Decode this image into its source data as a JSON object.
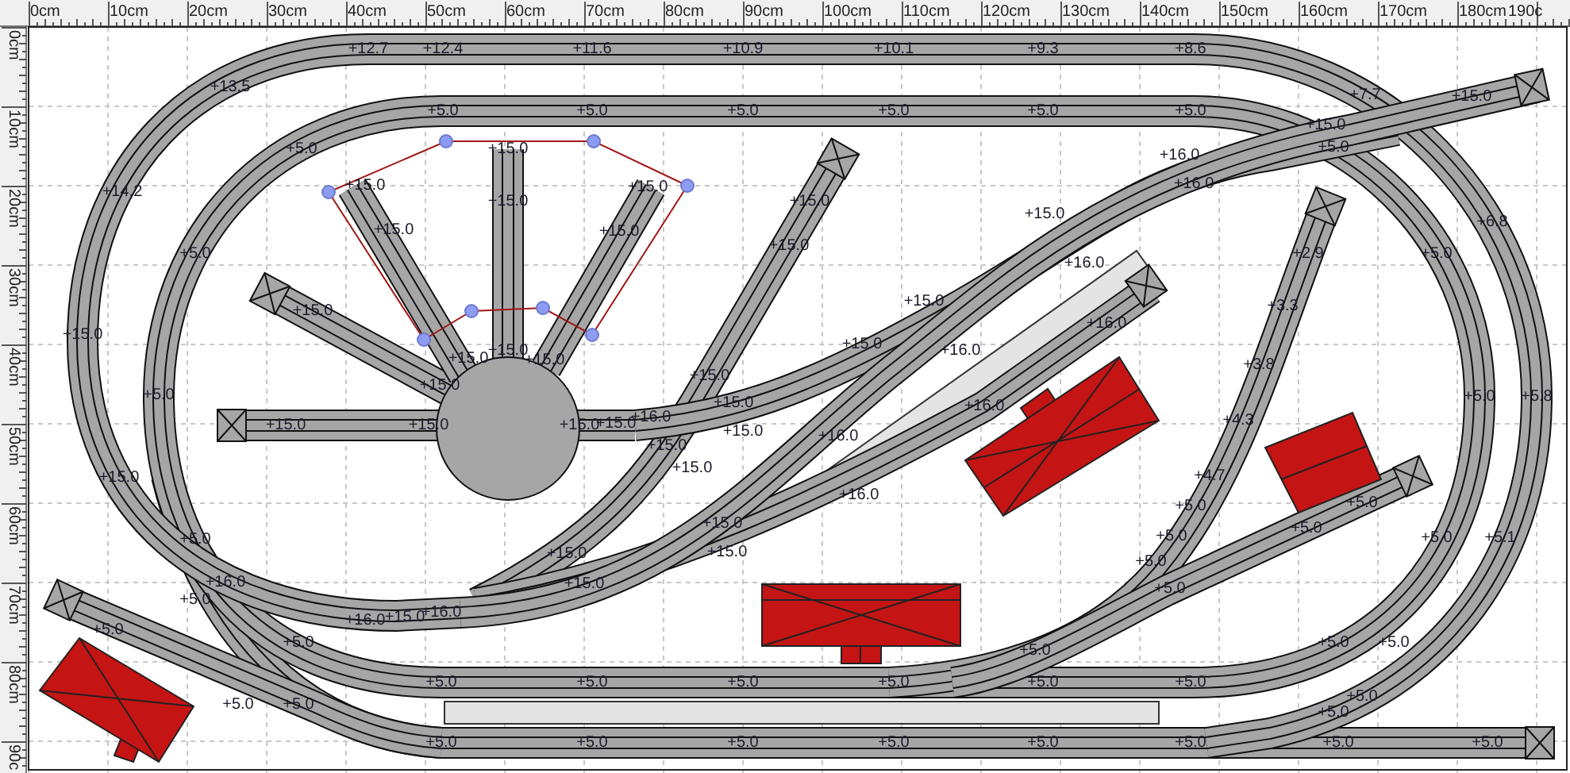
{
  "ruler": {
    "horizontal": [
      "0cm",
      "10cm",
      "20cm",
      "30cm",
      "40cm",
      "50cm",
      "60cm",
      "70cm",
      "80cm",
      "90cm",
      "100cm",
      "110cm",
      "120cm",
      "130cm",
      "140cm",
      "150cm",
      "160cm",
      "170cm",
      "180cm",
      "190c"
    ],
    "vertical": [
      "0cm",
      "10cm",
      "20cm",
      "30cm",
      "40cm",
      "50cm",
      "60cm",
      "70cm",
      "80cm",
      "90c"
    ]
  },
  "elevation_labels": [
    "+12.7",
    "+12.4",
    "+11.6",
    "+10.9",
    "+10.1",
    "+9.3",
    "+8.6",
    "+13.5",
    "+7.7",
    "+15.0",
    "+5.0",
    "+5.0",
    "+5.0",
    "+5.0",
    "+5.0",
    "+5.0",
    "+15.0",
    "+5.0",
    "+15.0",
    "+16.0",
    "+5.0",
    "+14.2",
    "+15.0",
    "+15.0",
    "+16.0",
    "+15.0",
    "+15.0",
    "+15.0",
    "+6.8",
    "+15.0",
    "+15.0",
    "+15.0",
    "+5.0",
    "+16.0",
    "+2.9",
    "+5.0",
    "+15.0",
    "+15.0",
    "+3.3",
    "+16.0",
    "+15.0",
    "+15.0",
    "+15.0",
    "+15.0",
    "+15.0",
    "+16.0",
    "+3.8",
    "+15.0",
    "+15.0",
    "+5.0",
    "+15.0",
    "+16.0",
    "+5.0",
    "+5.8",
    "+15.0",
    "+15.0",
    "+15.0",
    "+15.0",
    "+16.0",
    "+15.0",
    "+16.0",
    "+4.3",
    "+15.0",
    "+15.0",
    "+15.0",
    "+4.7",
    "+16.0",
    "+5.0",
    "+5.0",
    "+5.0",
    "+15.0",
    "+5.0",
    "+5.0",
    "+5.0",
    "+5.1",
    "+15.0",
    "+15.0",
    "+5.0",
    "+16.0",
    "+15.0",
    "+5.0",
    "+5.0",
    "+16.0",
    "+15.0",
    "+16.0",
    "+5.0",
    "+5.0",
    "+5.0",
    "+5.0",
    "+5.0",
    "+5.0",
    "+5.0",
    "+5.0",
    "+5.0",
    "+5.0",
    "+5.0",
    "+5.0",
    "+5.0",
    "+5.0",
    "+5.0",
    "+5.0",
    "+5.0",
    "+5.0",
    "+5.0",
    "+5.0",
    "+5.0",
    "+5.0",
    "+5.0"
  ]
}
